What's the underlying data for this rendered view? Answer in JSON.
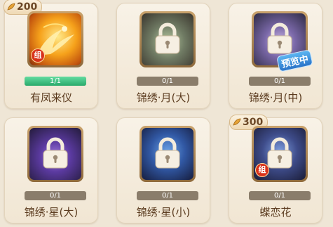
{
  "cards": [
    {
      "title": "有凤来仪",
      "progress": "1/1",
      "progress_value": 1,
      "price": "200",
      "badge": "组",
      "locked": false,
      "art": "gold-phoenix"
    },
    {
      "title": "锦绣·月(大)",
      "progress": "0/1",
      "progress_value": 0,
      "locked": true,
      "art": "green"
    },
    {
      "title": "锦绣·月(中)",
      "progress": "0/1",
      "progress_value": 0,
      "locked": true,
      "overlay": "预览中",
      "art": "purple"
    },
    {
      "title": "锦绣·星(大)",
      "progress": "0/1",
      "progress_value": 0,
      "locked": true,
      "art": "violet"
    },
    {
      "title": "锦绣·星(小)",
      "progress": "0/1",
      "progress_value": 0,
      "locked": true,
      "art": "blue"
    },
    {
      "title": "蝶恋花",
      "progress": "0/1",
      "progress_value": 0,
      "price": "300",
      "badge": "组",
      "locked": true,
      "art": "night"
    }
  ],
  "icons": {
    "price_icon": "feather-coin-icon",
    "lock": "lock-icon"
  },
  "colors": {
    "progress_fill": "#2aa96b",
    "progress_track": "#8a7d6b",
    "title": "#5a3a1e"
  }
}
